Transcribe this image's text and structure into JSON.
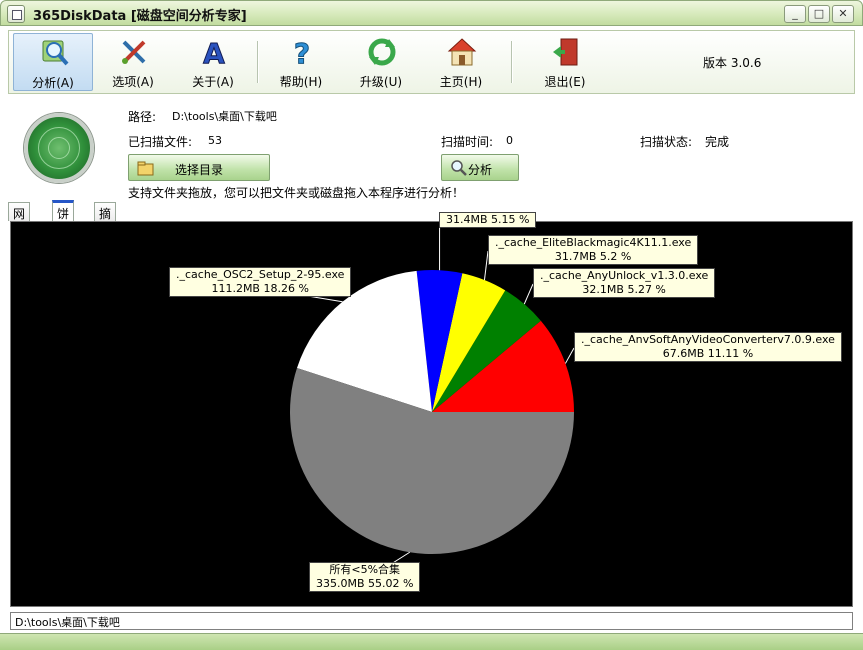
{
  "window": {
    "title": "365DiskData [磁盘空间分析专家]"
  },
  "toolbar": {
    "items": [
      {
        "label": "分析(A)",
        "icon": "magnifier-disk-icon",
        "active": true
      },
      {
        "label": "选项(A)",
        "icon": "tools-icon"
      },
      {
        "label": "关于(A)",
        "icon": "about-a-icon"
      },
      {
        "label": "帮助(H)",
        "icon": "help-question-icon"
      },
      {
        "label": "升级(U)",
        "icon": "refresh-upgrade-icon"
      },
      {
        "label": "主页(H)",
        "icon": "home-icon"
      },
      {
        "label": "退出(E)",
        "icon": "exit-door-icon"
      }
    ],
    "version": "版本 3.0.6"
  },
  "info": {
    "path_label": "路径:",
    "path_value": "D:\\tools\\桌面\\下载吧",
    "scanned_files_label": "已扫描文件:",
    "scanned_files_value": "53",
    "scan_time_label": "扫描时间:",
    "scan_time_value": "0",
    "scan_status_label": "扫描状态:",
    "scan_status_value": "完成",
    "select_dir_button": "选择目录",
    "analyze_button": "分析",
    "hint": "支持文件夹拖放，您可以把文件夹或磁盘拖入本程序进行分析！"
  },
  "tabs": [
    {
      "label": "网格"
    },
    {
      "label": "饼图",
      "selected": true
    },
    {
      "label": "摘要"
    }
  ],
  "chart_data": {
    "type": "pie",
    "slices": [
      {
        "name": "._cache_AnvSoftAnyVideoConverterv7.0.9.exe",
        "size": "67.6MB",
        "percent": 11.11,
        "label": "67.6MB 11.11 %",
        "color": "#ff0000"
      },
      {
        "name": "._cache_AnyUnlock_v1.3.0.exe",
        "size": "32.1MB",
        "percent": 5.27,
        "label": "32.1MB 5.27 %",
        "color": "#008000"
      },
      {
        "name": "._cache_EliteBlackmagic4K11.1.exe",
        "size": "31.7MB",
        "percent": 5.2,
        "label": "31.7MB 5.2 %",
        "color": "#ffff00"
      },
      {
        "name": "",
        "size": "31.4MB",
        "percent": 5.15,
        "label": "31.4MB 5.15 %",
        "color": "#0000ff"
      },
      {
        "name": "._cache_OSC2_Setup_2-95.exe",
        "size": "111.2MB",
        "percent": 18.26,
        "label": "111.2MB 18.26 %",
        "color": "#ffffff"
      },
      {
        "name": "所有<5%合集",
        "size": "335.0MB",
        "percent": 55.02,
        "label": "335.0MB 55.02 %",
        "color": "#808080"
      }
    ]
  },
  "status": {
    "path": "D:\\tools\\桌面\\下载吧"
  }
}
